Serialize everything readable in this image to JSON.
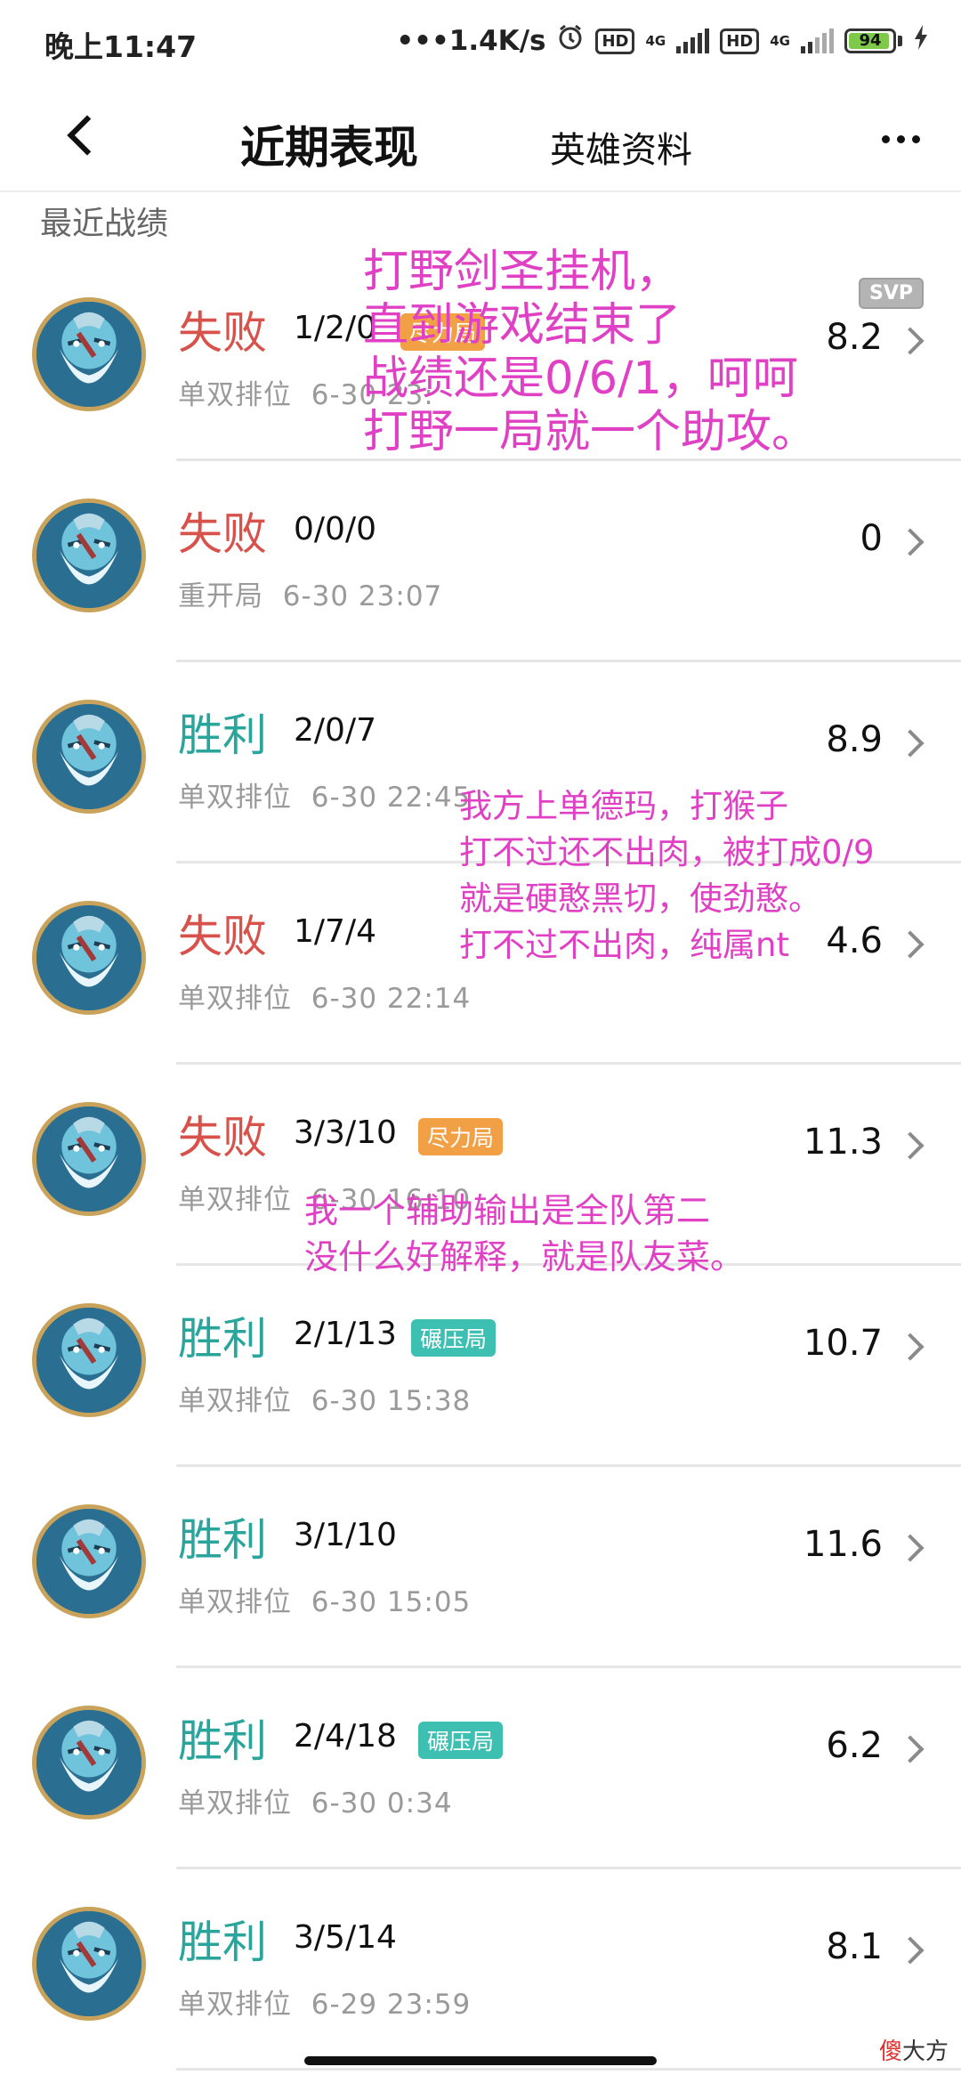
{
  "status_bar": {
    "time": "晚上11:47",
    "net_speed": "•••1.4K/s",
    "hd_label": "HD",
    "net_type": "4G",
    "battery": "94",
    "battery_level": 0.94,
    "icons": [
      "alarm-icon",
      "signal-icon",
      "charging-icon"
    ]
  },
  "nav": {
    "back_icon": "chevron-left-icon",
    "tab_active": "近期表现",
    "tab_other": "英雄资料",
    "more_icon": "more-dots-icon"
  },
  "section_title": "最近战绩",
  "matches": [
    {
      "result": "失败",
      "outcome": "lose",
      "kda": "1/2/0",
      "tag": "尽力局",
      "mode": "单双排位",
      "time": "6-30 23:",
      "score": "8.2",
      "badge": "SVP"
    },
    {
      "result": "失败",
      "outcome": "lose",
      "kda": "0/0/0",
      "tag": "",
      "mode": "重开局",
      "time": "6-30 23:07",
      "score": "0",
      "badge": ""
    },
    {
      "result": "胜利",
      "outcome": "win",
      "kda": "2/0/7",
      "tag": "",
      "mode": "单双排位",
      "time": "6-30 22:45",
      "score": "8.9",
      "badge": ""
    },
    {
      "result": "失败",
      "outcome": "lose",
      "kda": "1/7/4",
      "tag": "",
      "mode": "单双排位",
      "time": "6-30 22:14",
      "score": "4.6",
      "badge": ""
    },
    {
      "result": "失败",
      "outcome": "lose",
      "kda": "3/3/10",
      "tag": "尽力局",
      "mode": "单双排位",
      "time": "6-30 16:10",
      "score": "11.3",
      "badge": ""
    },
    {
      "result": "胜利",
      "outcome": "win",
      "kda": "2/1/13",
      "tag": "碾压局",
      "mode": "单双排位",
      "time": "6-30 15:38",
      "score": "10.7",
      "badge": ""
    },
    {
      "result": "胜利",
      "outcome": "win",
      "kda": "3/1/10",
      "tag": "",
      "mode": "单双排位",
      "time": "6-30 15:05",
      "score": "11.6",
      "badge": ""
    },
    {
      "result": "胜利",
      "outcome": "win",
      "kda": "2/4/18",
      "tag": "碾压局",
      "mode": "单双排位",
      "time": "6-30 0:34",
      "score": "6.2",
      "badge": ""
    },
    {
      "result": "胜利",
      "outcome": "win",
      "kda": "3/5/14",
      "tag": "",
      "mode": "单双排位",
      "time": "6-29 23:59",
      "score": "8.1",
      "badge": ""
    }
  ],
  "annotations": {
    "note1": "打野剑圣挂机，\n直到游戏结束了\n战绩还是0/6/1，呵呵\n打野一局就一个助攻。",
    "note2": "我方上单德玛，打猴子\n打不过还不出肉，被打成0/9\n就是硬憨黑切，使劲憨。\n打不过不出肉，纯属nt",
    "note3": "我一个辅助输出是全队第二\n没什么好解释，就是队友菜。"
  },
  "watermark": {
    "first": "傻",
    "rest": "大方"
  },
  "colors": {
    "lose": "#d8524c",
    "win": "#2aa59c",
    "annotation": "#e040c4",
    "tag_orange": "#f2a046",
    "tag_teal": "#3dbfb2",
    "avatar_border": "#c9a35b"
  }
}
